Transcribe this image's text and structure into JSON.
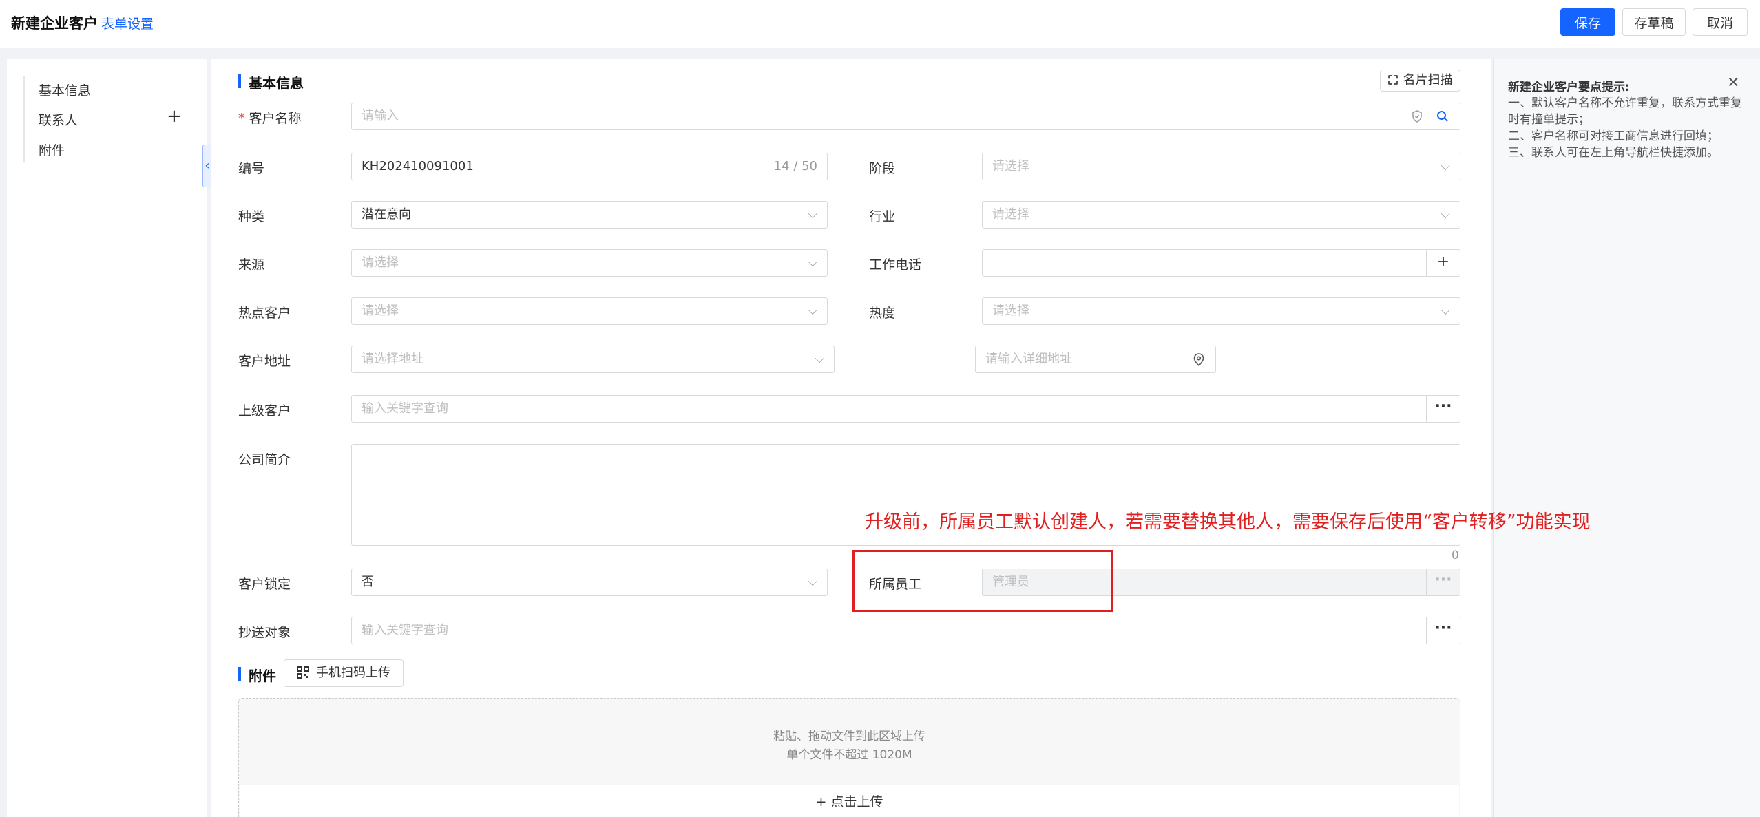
{
  "header": {
    "title": "新建企业客户",
    "form_settings": "表单设置",
    "save": "保存",
    "save_draft": "存草稿",
    "cancel": "取消"
  },
  "nav": {
    "items": [
      {
        "label": "基本信息"
      },
      {
        "label": "联系人"
      },
      {
        "label": "附件"
      }
    ],
    "collapse_glyph": "《"
  },
  "basic_section": {
    "title": "基本信息",
    "card_scan": "名片扫描"
  },
  "fields": {
    "customer_name": {
      "label": "客户名称",
      "required_mark": "*",
      "placeholder": "请输入"
    },
    "code": {
      "label": "编号",
      "value": "KH202410091001",
      "counter": "14 / 50"
    },
    "stage": {
      "label": "阶段",
      "placeholder": "请选择"
    },
    "category": {
      "label": "种类",
      "value": "潜在意向"
    },
    "industry": {
      "label": "行业",
      "placeholder": "请选择"
    },
    "source": {
      "label": "来源",
      "placeholder": "请选择"
    },
    "work_phone": {
      "label": "工作电话",
      "add": "+"
    },
    "hot_customer": {
      "label": "热点客户",
      "placeholder": "请选择"
    },
    "heat": {
      "label": "热度",
      "placeholder": "请选择"
    },
    "address": {
      "label": "客户地址",
      "placeholder": "请选择地址",
      "detail_placeholder": "请输入详细地址"
    },
    "parent_customer": {
      "label": "上级客户",
      "placeholder": "输入关键字查询",
      "more": "···"
    },
    "company_intro": {
      "label": "公司简介",
      "counter": "0"
    },
    "customer_lock": {
      "label": "客户锁定",
      "value": "否"
    },
    "owner": {
      "label": "所属员工",
      "value": "管理员",
      "more": "···"
    },
    "cc": {
      "label": "抄送对象",
      "placeholder": "输入关键字查询",
      "more": "···"
    }
  },
  "attachment_section": {
    "title": "附件",
    "qr_upload": "手机扫码上传",
    "drop_line1": "粘贴、拖动文件到此区域上传",
    "drop_line2": "单个文件不超过 1020M",
    "click_upload": "+ 点击上传"
  },
  "tips": {
    "title": "新建企业客户要点提示:",
    "lines": [
      "一、默认客户名称不允许重复，联系方式重复时有撞单提示；",
      "二、客户名称可对接工商信息进行回填；",
      "三、联系人可在左上角导航栏快捷添加。"
    ],
    "close": "✕"
  },
  "annotation": {
    "text": "升级前，所属员工默认创建人，若需要替换其他人，需要保存后使用“客户转移”功能实现"
  },
  "colors": {
    "primary": "#1664ff",
    "annotation_red": "#e02020",
    "required_red": "#f53f3f"
  }
}
